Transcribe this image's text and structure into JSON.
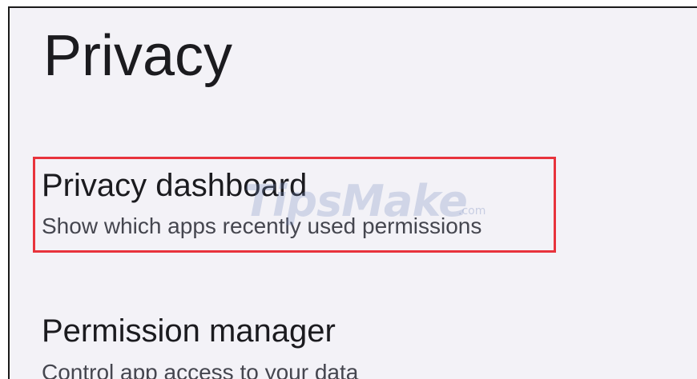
{
  "page": {
    "title": "Privacy"
  },
  "items": [
    {
      "title": "Privacy dashboard",
      "summary": "Show which apps recently used permissions",
      "highlighted": true
    },
    {
      "title": "Permission manager",
      "summary": "Control app access to your data",
      "highlighted": false
    }
  ],
  "watermark": {
    "text": "TipsMake",
    "suffix": ".com"
  },
  "colors": {
    "background": "#f3f2f7",
    "highlight": "#e8333c",
    "text_primary": "#1b1b1f",
    "text_secondary": "#45464f"
  }
}
